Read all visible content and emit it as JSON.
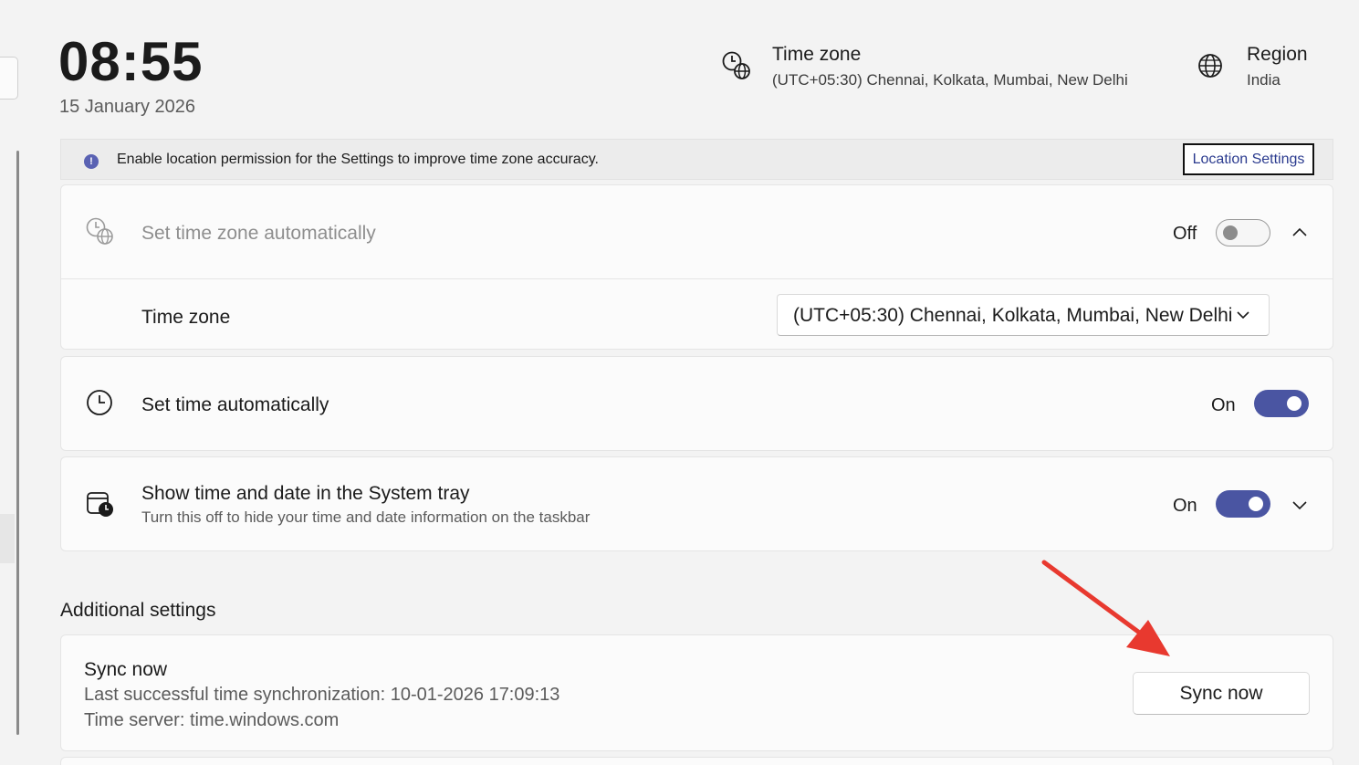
{
  "header": {
    "time": "08:55",
    "date": "15 January 2026",
    "time_zone": {
      "title": "Time zone",
      "value": "(UTC+05:30) Chennai, Kolkata, Mumbai, New Delhi",
      "icon": "clock-globe-icon"
    },
    "region": {
      "title": "Region",
      "value": "India",
      "icon": "globe-icon"
    }
  },
  "info_bar": {
    "message": "Enable location permission for the Settings to improve time zone accuracy.",
    "icon_glyph": "!",
    "button_label": "Location Settings"
  },
  "set_time_zone_auto": {
    "label": "Set time zone automatically",
    "state": "Off",
    "enabled": false,
    "expanded": true
  },
  "time_zone_row": {
    "label": "Time zone",
    "selected": "(UTC+05:30) Chennai, Kolkata, Mumbai, New Delhi"
  },
  "set_time_auto": {
    "label": "Set time automatically",
    "state": "On",
    "enabled": true
  },
  "system_tray": {
    "label": "Show time and date in the System tray",
    "description": "Turn this off to hide your time and date information on the taskbar",
    "state": "On",
    "enabled": true
  },
  "additional": {
    "section_title": "Additional settings",
    "sync": {
      "title": "Sync now",
      "last_sync": "Last successful time synchronization: 10-01-2026 17:09:13",
      "server": "Time server: time.windows.com",
      "button_label": "Sync now"
    }
  },
  "colors": {
    "accent": "#4a55a2",
    "annotation_arrow": "#e8392f",
    "background": "#f3f3f3",
    "card": "#fbfbfb"
  }
}
